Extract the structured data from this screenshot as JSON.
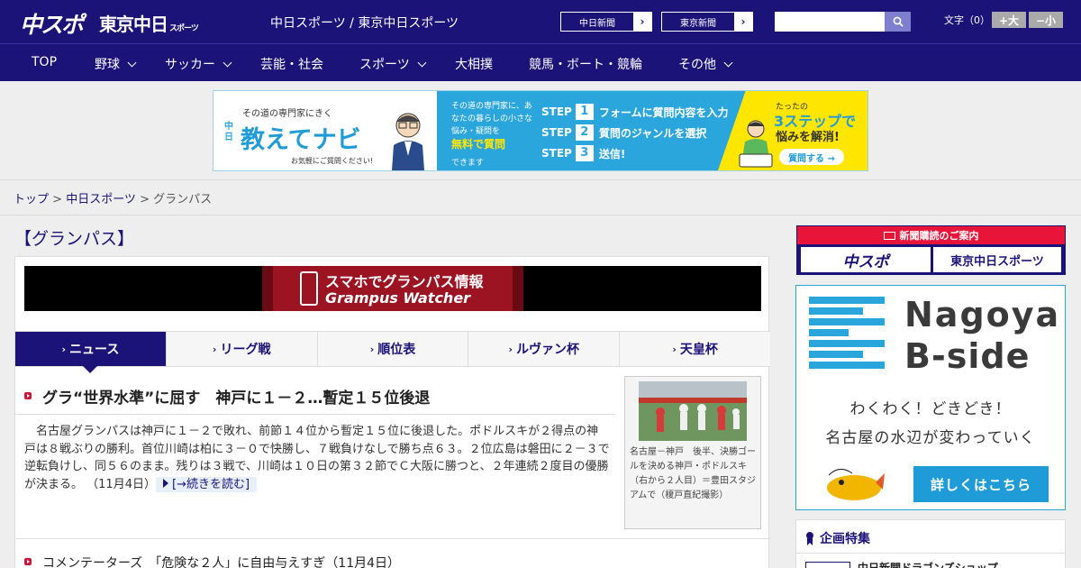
{
  "header": {
    "logo_chuspo": "中スポ",
    "logo_tokyo": "東京中日",
    "logo_tokyo_sub": "スポーツ",
    "site_title": "中日スポーツ / 東京中日スポーツ",
    "ext_links": [
      "中日新聞",
      "東京新聞"
    ],
    "search": {
      "value": "",
      "placeholder": ""
    },
    "font_size_label": "文字（0）",
    "font_larger": "+大",
    "font_smaller": "−小",
    "colors": {
      "navy": "#1c1379"
    }
  },
  "nav": {
    "items": [
      {
        "label": "TOP",
        "has_menu": false
      },
      {
        "label": "野球",
        "has_menu": true
      },
      {
        "label": "サッカー",
        "has_menu": true
      },
      {
        "label": "芸能・社会",
        "has_menu": false
      },
      {
        "label": "スポーツ",
        "has_menu": true
      },
      {
        "label": "大相撲",
        "has_menu": false
      },
      {
        "label": "競馬・ボート・競輪",
        "has_menu": false
      },
      {
        "label": "その他",
        "has_menu": true
      }
    ]
  },
  "ad_banner": {
    "small": "その道の専門家にきく",
    "brand": "中日",
    "main": "教えてナビ",
    "ask": "お気軽にご質問ください!",
    "desc": "その道の専門家に、あなたの暮らしの小さな悩み・疑問を",
    "free": "無料で質問",
    "desc2": "できます",
    "steps": [
      {
        "label": "STEP",
        "num": "1",
        "text": "フォームに質問内容を入力"
      },
      {
        "label": "STEP",
        "num": "2",
        "text": "質問のジャンルを選択"
      },
      {
        "label": "STEP",
        "num": "3",
        "text": "送信!"
      }
    ],
    "right_small": "たったの",
    "right_big": "3ステップで",
    "right_sub": "悩みを解消!",
    "cta": "質問する →"
  },
  "breadcrumb": {
    "home": "トップ",
    "sep": " > ",
    "section": "中日スポーツ",
    "current": "グランパス"
  },
  "page_title": "【グランパス】",
  "gw_banner": {
    "line1": "スマホでグランパス情報",
    "line2": "Grampus Watcher"
  },
  "tabs": [
    {
      "label": "ニュース",
      "active": true
    },
    {
      "label": "リーグ戦",
      "active": false
    },
    {
      "label": "順位表",
      "active": false
    },
    {
      "label": "ルヴァン杯",
      "active": false
    },
    {
      "label": "天皇杯",
      "active": false
    }
  ],
  "lead_article": {
    "title": "グラ“世界水準”に屈す　神戸に１－２…暫定１５位後退",
    "body": "名古屋グランパスは神戸に１－２で敗れ、前節１４位から暫定１５位に後退した。ポドルスキが２得点の神戸は８戦ぶりの勝利。首位川崎は柏に３－０で快勝し、７戦負けなしで勝ち点６３。２位広島は磐田に２－３で逆転負けし、同５６のまま。残りは３戦で、川崎は１０日の第３２節でＣ大阪に勝つと、２年連続２度目の優勝が決まる。",
    "date": "（11月4日）",
    "read_more": "[→続きを読む]",
    "photo_caption": "名古屋－神戸　後半、決勝ゴールを決める神戸・ポドルスキ（右から２人目）＝豊田スタジアムで（榎戸直紀撮影）"
  },
  "sub_article": {
    "title": "コメンテーターズ　「危険な２人」に自由与えすぎ（11月4日）"
  },
  "sidebar": {
    "subscribe_head": "新聞購読のご案内",
    "subscribe_logos": [
      "中スポ",
      "東京中日スポーツ"
    ],
    "nagoya_bside": {
      "title1": "Nagoya",
      "title2": "B-side",
      "copy1": "わくわく！どきどき！",
      "copy2": "名古屋の水辺が変わっていく",
      "button": "詳しくはこちら"
    },
    "features": {
      "head": "企画特集",
      "item": "中日新聞ドラゴンズショップ"
    }
  }
}
